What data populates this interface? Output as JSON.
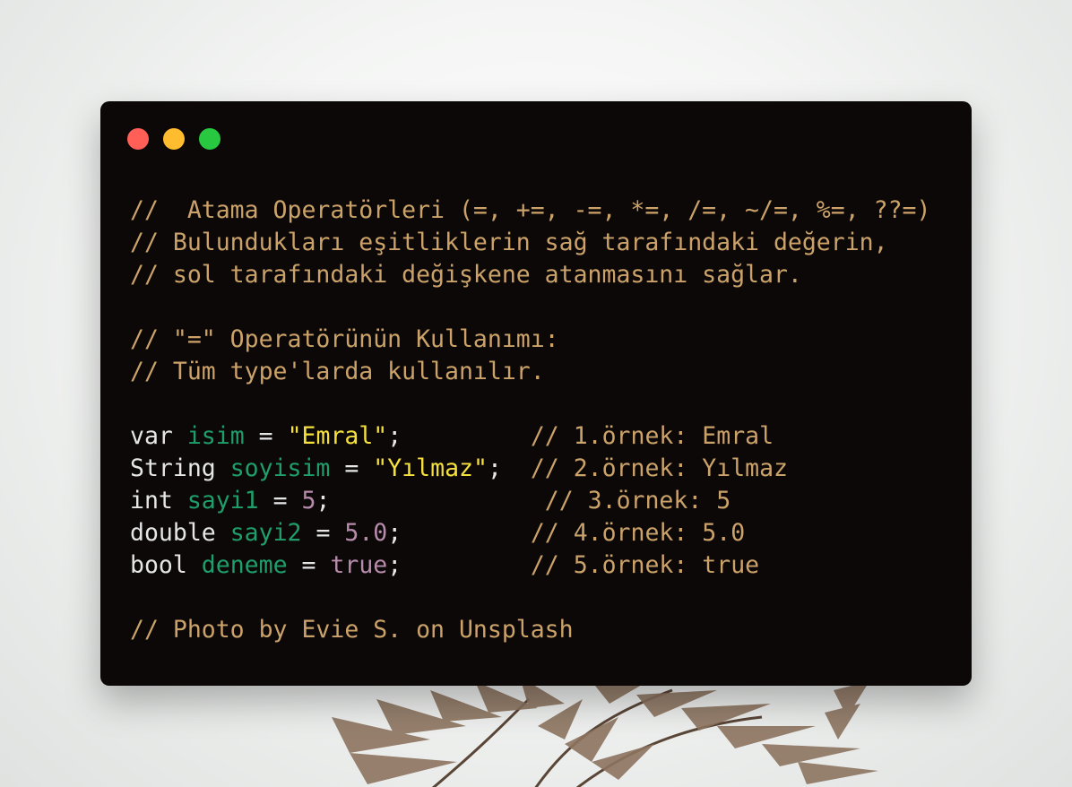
{
  "window": {
    "controls": [
      {
        "name": "close",
        "color": "#ff5f57"
      },
      {
        "name": "minimize",
        "color": "#febc2e"
      },
      {
        "name": "zoom",
        "color": "#28c840"
      }
    ]
  },
  "colors": {
    "background": "#0c0808",
    "comment": "#cba269",
    "identifier": "#1f9e6a",
    "string": "#f6e13c",
    "number": "#b78bab",
    "plain": "#e6e6e6"
  },
  "code": {
    "header_comments": [
      "//  Atama Operatörleri (=, +=, -=, *=, /=, ~/=, %=, ??=)",
      "// Bulundukları eşitliklerin sağ tarafındaki değerin,",
      "// sol tarafındaki değişkene atanmasını sağlar."
    ],
    "usage_comments": [
      "// \"=\" Operatörünün Kullanımı:",
      "// Tüm type'larda kullanılır."
    ],
    "statements": [
      {
        "type": "var",
        "name": "isim",
        "op": "=",
        "value": "\"Emral\"",
        "value_kind": "string",
        "end": ";",
        "pad": "         ",
        "comment": "// 1.örnek: Emral"
      },
      {
        "type": "String",
        "name": "soyisim",
        "op": "=",
        "value": "\"Yılmaz\"",
        "value_kind": "string",
        "end": ";",
        "pad": "  ",
        "comment": "// 2.örnek: Yılmaz"
      },
      {
        "type": "int",
        "name": "sayi1",
        "op": "=",
        "value": "5",
        "value_kind": "number",
        "end": ";",
        "pad": "               ",
        "comment": "// 3.örnek: 5"
      },
      {
        "type": "double",
        "name": "sayi2",
        "op": "=",
        "value": "5.0",
        "value_kind": "number",
        "end": ";",
        "pad": "         ",
        "comment": "// 4.örnek: 5.0"
      },
      {
        "type": "bool",
        "name": "deneme",
        "op": "=",
        "value": "true",
        "value_kind": "number",
        "end": ";",
        "pad": "         ",
        "comment": "// 5.örnek: true"
      }
    ],
    "footer_comment": "// Photo by Evie S. on Unsplash"
  }
}
